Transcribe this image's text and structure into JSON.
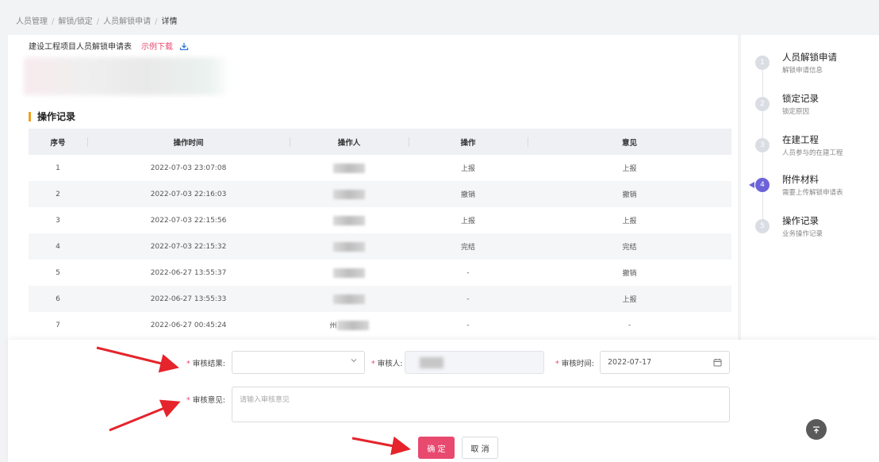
{
  "breadcrumb": {
    "items": [
      "人员管理",
      "解锁/锁定",
      "人员解锁申请"
    ],
    "separator": "/",
    "current": "详情"
  },
  "form": {
    "table_label": "建设工程项目人员解锁申请表",
    "sample_download": "示例下载",
    "download_icon": "download-icon"
  },
  "operation_log": {
    "title": "操作记录",
    "columns": [
      "序号",
      "操作时间",
      "操作人",
      "操作",
      "意见"
    ],
    "rows": [
      {
        "no": "1",
        "time": "2022-07-03 23:07:08",
        "operator": "",
        "action": "上报",
        "opinion": "上报"
      },
      {
        "no": "2",
        "time": "2022-07-03 22:16:03",
        "operator": "",
        "action": "撤销",
        "opinion": "撤销"
      },
      {
        "no": "3",
        "time": "2022-07-03 22:15:56",
        "operator": "",
        "action": "上报",
        "opinion": "上报"
      },
      {
        "no": "4",
        "time": "2022-07-03 22:15:32",
        "operator": "",
        "action": "完结",
        "opinion": "完结"
      },
      {
        "no": "5",
        "time": "2022-06-27 13:55:37",
        "operator": "",
        "action": "-",
        "opinion": "撤销"
      },
      {
        "no": "6",
        "time": "2022-06-27 13:55:33",
        "operator": "",
        "action": "-",
        "opinion": "上报"
      },
      {
        "no": "7",
        "time": "2022-06-27 00:45:24",
        "operator": "州",
        "action": "-",
        "opinion": "-"
      }
    ]
  },
  "steps": [
    {
      "num": "1",
      "title": "人员解锁申请",
      "desc": "解锁申请信息"
    },
    {
      "num": "2",
      "title": "锁定记录",
      "desc": "锁定原因"
    },
    {
      "num": "3",
      "title": "在建工程",
      "desc": "人员参与的在建工程"
    },
    {
      "num": "4",
      "title": "附件材料",
      "desc": "需要上传解锁申请表"
    },
    {
      "num": "5",
      "title": "操作记录",
      "desc": "业务操作记录"
    }
  ],
  "active_step": "4",
  "review": {
    "result_label": "审核结果:",
    "result_value": "",
    "reviewer_label": "审核人:",
    "time_label": "审核时间:",
    "time_value": "2022-07-17",
    "opinion_label": "审核意见:",
    "opinion_placeholder": "请输入审核意见",
    "confirm": "确 定",
    "cancel": "取 消",
    "back_to_top_icon": "arrow-up-to-top-icon",
    "required_mark": "*"
  },
  "colors": {
    "accent": "#e84a6f",
    "step_active": "#6c63d9",
    "section_bar": "#f0a020",
    "annotation_arrow": "#e5242b"
  }
}
